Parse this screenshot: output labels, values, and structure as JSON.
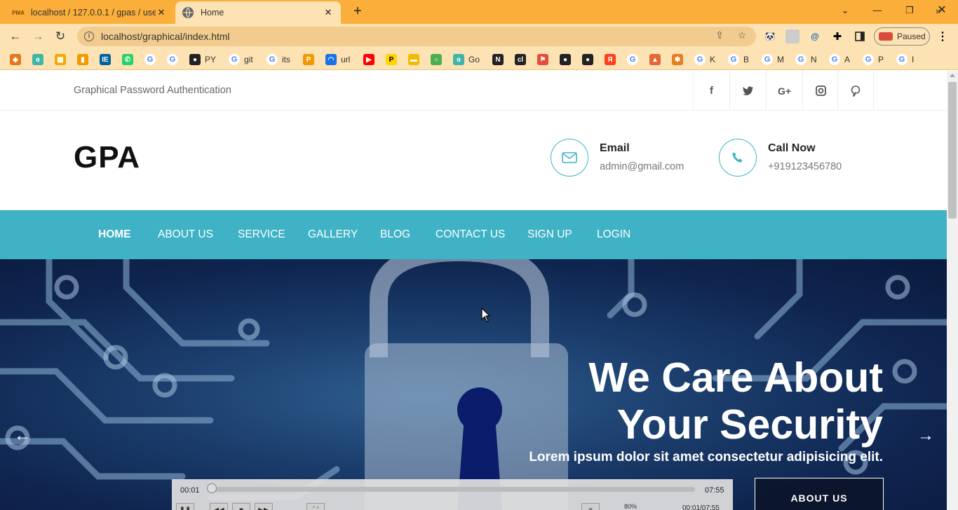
{
  "browser": {
    "tabs": [
      {
        "title": "localhost / 127.0.0.1 / gpas / use",
        "favicon": "phpmyadmin-icon",
        "favicon_text": "PMA",
        "active": false
      },
      {
        "title": "Home",
        "favicon": "globe-icon",
        "active": true
      }
    ],
    "url": "localhost/graphical/index.html",
    "profile_label": "Paused",
    "bookmarks": [
      {
        "label": "",
        "icon": "diamond-icon",
        "color": "#e8771a"
      },
      {
        "label": "",
        "icon": "bird-icon",
        "color": "#40b5a6"
      },
      {
        "label": "",
        "icon": "calendar-icon",
        "color": "#f2a900"
      },
      {
        "label": "",
        "icon": "bar-chart-icon",
        "color": "#f29900"
      },
      {
        "label": "",
        "icon": "ieee-icon",
        "color": "#00629b"
      },
      {
        "label": "",
        "icon": "whatsapp-icon",
        "color": "#25d366"
      },
      {
        "label": "",
        "icon": "google-icon",
        "color": "#4285f4"
      },
      {
        "label": "",
        "icon": "google-icon",
        "color": "#4285f4"
      },
      {
        "label": "PY",
        "icon": "github-icon",
        "color": "#222222"
      },
      {
        "label": "git",
        "icon": "google-icon",
        "color": "#4285f4"
      },
      {
        "label": "its",
        "icon": "google-icon",
        "color": "#4285f4"
      },
      {
        "label": "",
        "icon": "phpmyadmin-icon",
        "color": "#f29900"
      },
      {
        "label": "url",
        "icon": "wifi-icon",
        "color": "#1a73e8"
      },
      {
        "label": "",
        "icon": "youtube-icon",
        "color": "#ff0000"
      },
      {
        "label": "",
        "icon": "p-icon",
        "color": "#ffd400"
      },
      {
        "label": "",
        "icon": "folder-icon",
        "color": "#f2b900"
      },
      {
        "label": "",
        "icon": "ring-icon",
        "color": "#4caf50"
      },
      {
        "label": "Go",
        "icon": "bird-icon",
        "color": "#40b5a6"
      },
      {
        "label": "",
        "icon": "notion-icon",
        "color": "#222222"
      },
      {
        "label": "",
        "icon": "cl-icon",
        "color": "#222222"
      },
      {
        "label": "",
        "icon": "runner-icon",
        "color": "#e74c3c"
      },
      {
        "label": "",
        "icon": "circle-icon",
        "color": "#222222"
      },
      {
        "label": "",
        "icon": "circle-icon",
        "color": "#222222"
      },
      {
        "label": "",
        "icon": "yandex-icon",
        "color": "#fc3f1d"
      },
      {
        "label": "",
        "icon": "google-icon",
        "color": "#4285f4"
      },
      {
        "label": "",
        "icon": "matlab-icon",
        "color": "#e16737"
      },
      {
        "label": "",
        "icon": "paw-icon",
        "color": "#e67e22"
      },
      {
        "label": "K",
        "icon": "google-icon",
        "color": "#4285f4"
      },
      {
        "label": "B",
        "icon": "google-icon",
        "color": "#4285f4"
      },
      {
        "label": "M",
        "icon": "google-icon",
        "color": "#4285f4"
      },
      {
        "label": "N",
        "icon": "google-icon",
        "color": "#4285f4"
      },
      {
        "label": "A",
        "icon": "google-icon",
        "color": "#4285f4"
      },
      {
        "label": "P",
        "icon": "google-icon",
        "color": "#4285f4"
      },
      {
        "label": "I",
        "icon": "google-icon",
        "color": "#4285f4"
      }
    ]
  },
  "site": {
    "tagline": "Graphical Password Authentication",
    "social": [
      "facebook-icon",
      "twitter-icon",
      "google-plus-icon",
      "instagram-icon",
      "pinterest-icon"
    ],
    "logo": "GPA",
    "email": {
      "title": "Email",
      "value": "admin@gmail.com"
    },
    "call": {
      "title": "Call Now",
      "value": "+919123456780"
    },
    "nav": [
      "HOME",
      "ABOUT US",
      "SERVICE",
      "GALLERY",
      "BLOG",
      "CONTACT US",
      "SIGN UP",
      "LOGIN"
    ],
    "accent": "#3fb2c6"
  },
  "hero": {
    "headline_line1": "We Care About",
    "headline_line2": "Your Security",
    "subheadline": "Lorem ipsum dolor sit amet consectetur adipisicing elit.",
    "cta": "ABOUT US",
    "prev_arrow": "←",
    "next_arrow": "→"
  },
  "player": {
    "current_time": "00:01",
    "duration": "07:55",
    "volume": "80%",
    "time_display": "00:01/07:55",
    "progress": 0.002
  }
}
